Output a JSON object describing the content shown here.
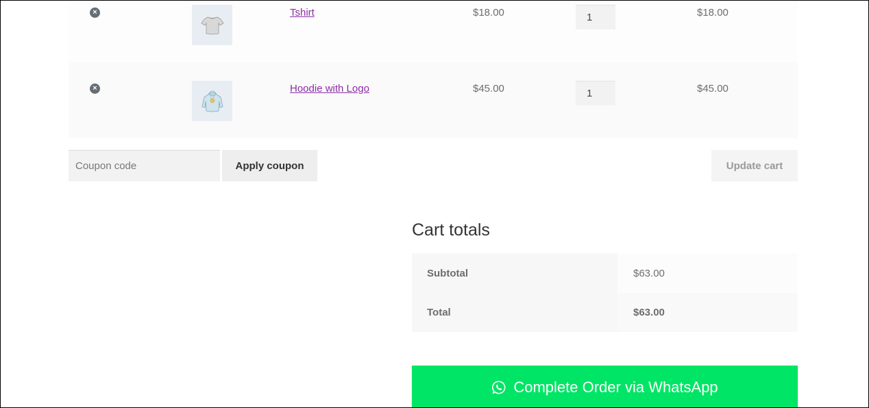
{
  "cart": {
    "items": [
      {
        "name": "Tshirt",
        "image": "tshirt-thumbnail",
        "price": "$18.00",
        "quantity": "1",
        "subtotal": "$18.00",
        "remove_icon": "×"
      },
      {
        "name": "Hoodie with Logo",
        "image": "hoodie-thumbnail",
        "price": "$45.00",
        "quantity": "1",
        "subtotal": "$45.00",
        "remove_icon": "×"
      }
    ],
    "coupon": {
      "placeholder": "Coupon code",
      "value": "",
      "apply_label": "Apply coupon"
    },
    "update_label": "Update cart"
  },
  "totals": {
    "title": "Cart totals",
    "rows": [
      {
        "label": "Subtotal",
        "value": "$63.00"
      },
      {
        "label": "Total",
        "value": "$63.00"
      }
    ]
  },
  "checkout": {
    "whatsapp_label": "Complete Order via WhatsApp",
    "icon": "whatsapp-icon",
    "color": "#00e565"
  },
  "colors": {
    "link": "#8b2ca6",
    "text": "#6d6d6d"
  }
}
